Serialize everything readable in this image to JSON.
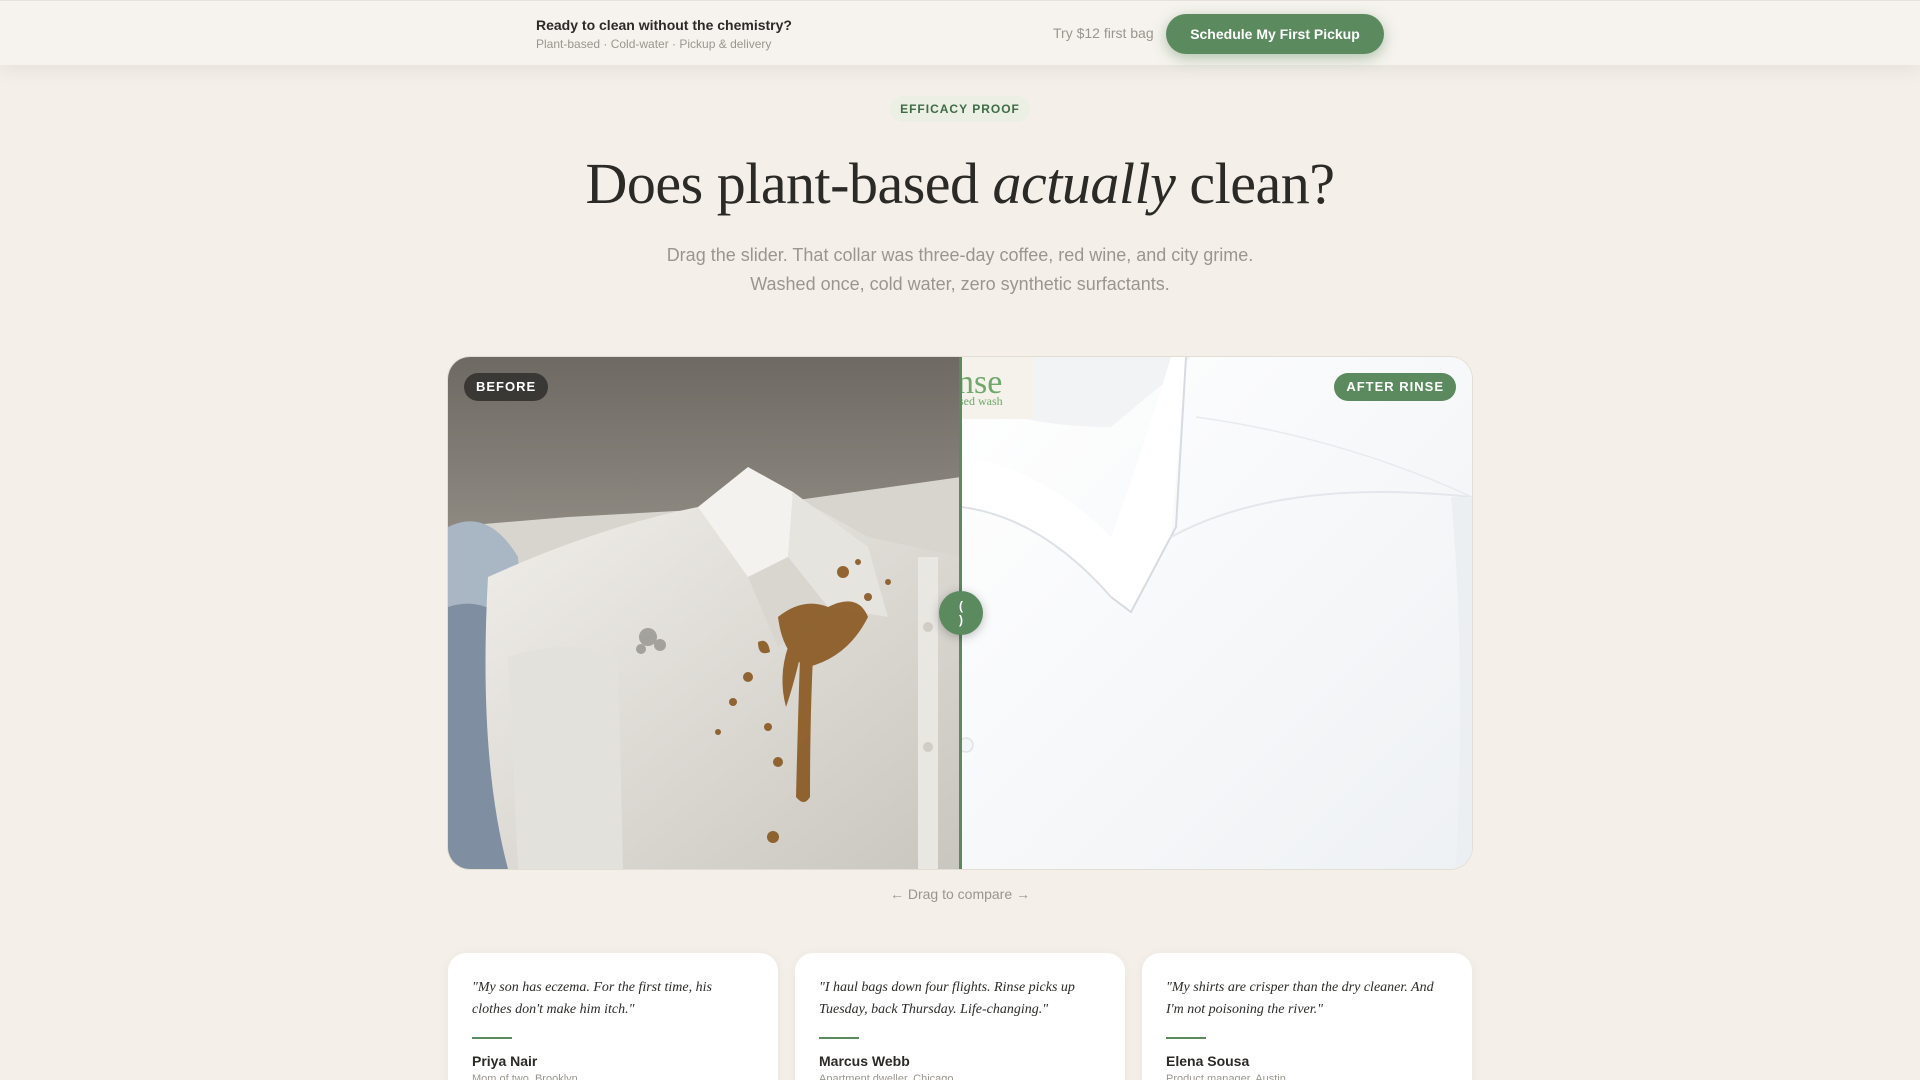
{
  "topbar": {
    "title": "Ready to clean without the chemistry?",
    "subtitle": "Plant-based · Cold-water · Pickup & delivery",
    "offer": "Try $12 first bag",
    "cta_label": "Schedule My First Pickup"
  },
  "hero": {
    "eyebrow": "EFFICACY PROOF",
    "headline_start": "Does plant-based ",
    "headline_em": "actually",
    "headline_end": " clean?",
    "subhead": "Drag the slider. That collar was three-day coffee, red wine, and city grime. Washed once, cold water, zero synthetic surfactants."
  },
  "compare": {
    "before_label": "BEFORE",
    "after_label": "AFTER RINSE",
    "handle_left_glyph": "(",
    "handle_right_glyph": ")",
    "slider_position_percent": 50,
    "tag_text": "nse",
    "tag_subtext": "sed wash",
    "hint": "← Drag to compare →"
  },
  "testimonials": [
    {
      "quote": "\"My son has eczema. For the first time, his clothes don't make him itch.\"",
      "name": "Priya Nair",
      "role": "Mom of two, Brooklyn"
    },
    {
      "quote": "\"I haul bags down four flights. Rinse picks up Tuesday, back Thursday. Life-changing.\"",
      "name": "Marcus Webb",
      "role": "Apartment dweller, Chicago"
    },
    {
      "quote": "\"My shirts are crisper than the dry cleaner. And I'm not poisoning the river.\"",
      "name": "Elena Sousa",
      "role": "Product manager, Austin"
    }
  ],
  "colors": {
    "brand_green": "#5b8a5e",
    "background": "#f4f0e9",
    "stain": "#8a5a24"
  }
}
